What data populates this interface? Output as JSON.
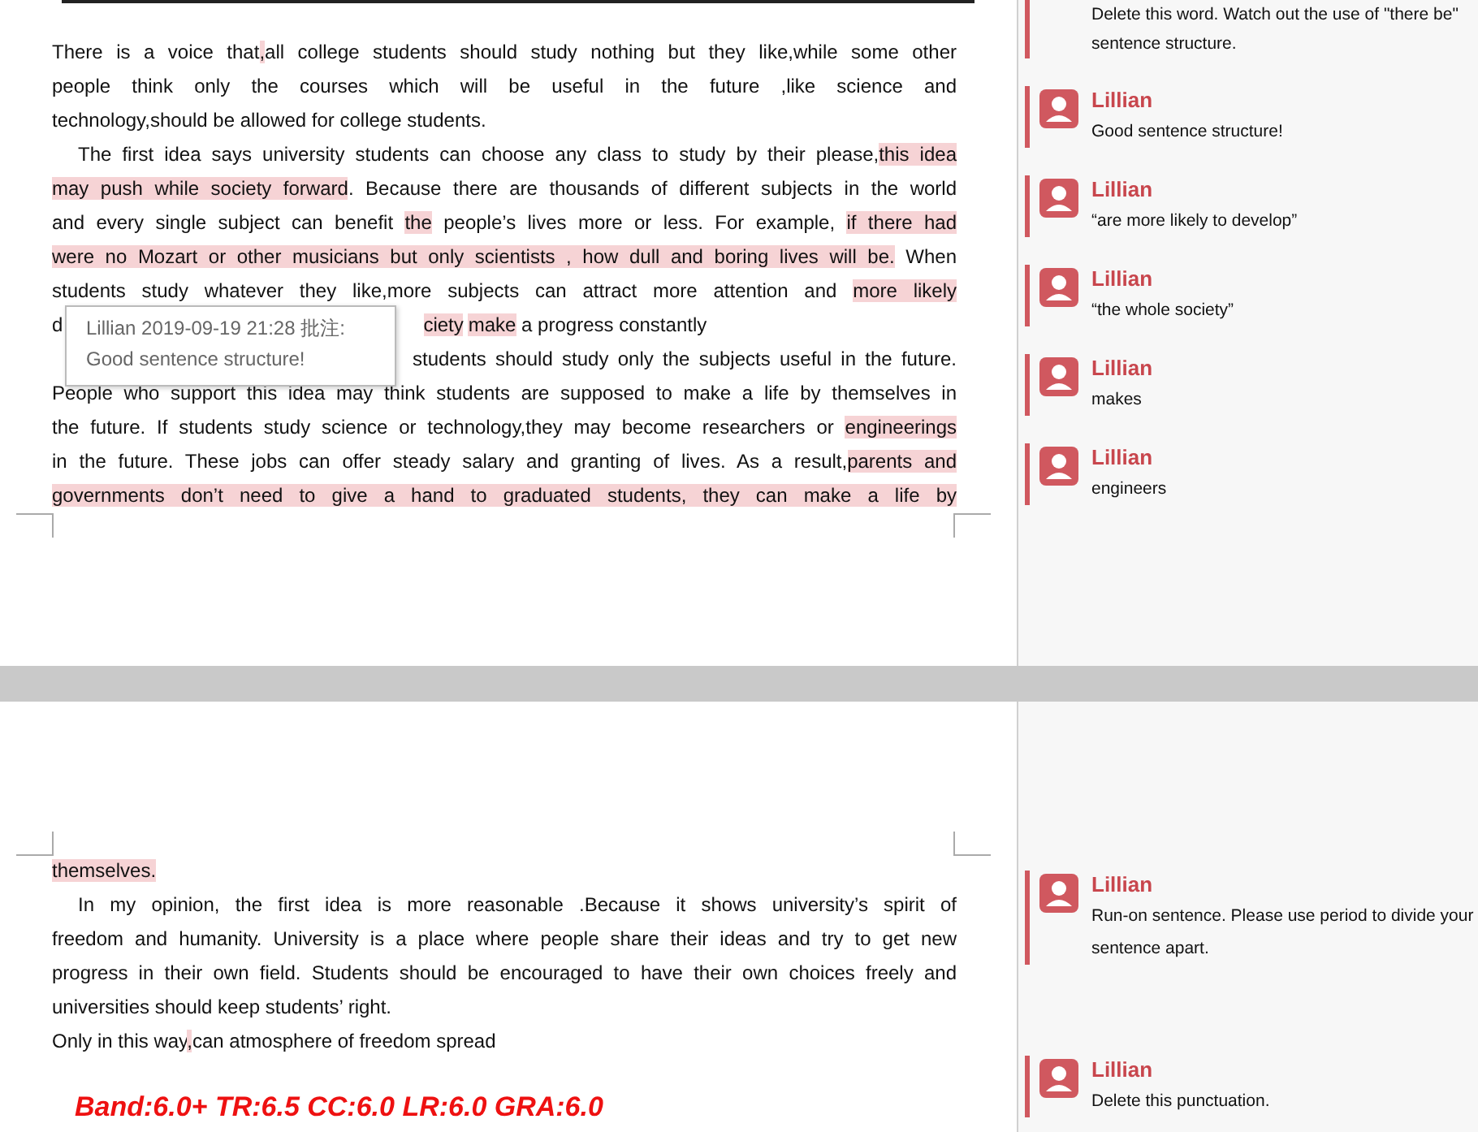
{
  "pages": [
    {
      "lines": [
        {
          "indent": false,
          "last": false,
          "segs": [
            {
              "text": "There is a voice that",
              "hl": false
            },
            {
              "text": ",",
              "hl": true
            },
            {
              "text": "all college students should study nothing but they like,while some other",
              "hl": false
            }
          ]
        },
        {
          "indent": false,
          "last": false,
          "segs": [
            {
              "text": "people think only the courses which will be useful in the future ,like science and",
              "hl": false
            }
          ]
        },
        {
          "indent": false,
          "last": true,
          "segs": [
            {
              "text": "technology,should be allowed for college students.",
              "hl": false
            }
          ]
        },
        {
          "indent": true,
          "last": false,
          "segs": [
            {
              "text": "The first idea says university students can choose any class to study by their please,",
              "hl": false
            },
            {
              "text": "this idea",
              "hl": true
            }
          ]
        },
        {
          "indent": false,
          "last": false,
          "segs": [
            {
              "text": "may push while society forward",
              "hl": true
            },
            {
              "text": ". Because there are thousands of different subjects in the world",
              "hl": false
            }
          ]
        },
        {
          "indent": false,
          "last": false,
          "segs": [
            {
              "text": "and every single subject can benefit ",
              "hl": false
            },
            {
              "text": "the",
              "hl": true
            },
            {
              "text": " people’s lives more or less. For example, ",
              "hl": false
            },
            {
              "text": "if there had",
              "hl": true
            }
          ]
        },
        {
          "indent": false,
          "last": false,
          "segs": [
            {
              "text": "were no Mozart or other musicians but only scientists , how dull and boring lives will be.",
              "hl": true
            },
            {
              "text": " When",
              "hl": false
            }
          ]
        },
        {
          "indent": false,
          "last": false,
          "segs": [
            {
              "text": "students study whatever they like,more subjects can attract more attention and ",
              "hl": false
            },
            {
              "text": "more likely",
              "hl": true
            }
          ]
        },
        {
          "indent": false,
          "last": true,
          "segs": [
            {
              "text": "d",
              "hl": false
            },
            {
              "text": "ciety",
              "hl": true,
              "gap_before": true
            },
            {
              "text": "make",
              "hl": true
            },
            {
              "text": " a progress constantly",
              "hl": false
            }
          ]
        },
        {
          "indent": false,
          "last": false,
          "segs": [
            {
              "text": "students should study only the subjects useful in the future.",
              "hl": false,
              "gap_before": true
            }
          ]
        },
        {
          "indent": false,
          "last": false,
          "segs": [
            {
              "text": "People who support this idea may think students are supposed to make a life by themselves in",
              "hl": false
            }
          ]
        },
        {
          "indent": false,
          "last": false,
          "segs": [
            {
              "text": "the future. If students study science or technology,they may become researchers or ",
              "hl": false
            },
            {
              "text": "engineerings",
              "hl": true
            }
          ]
        },
        {
          "indent": false,
          "last": false,
          "segs": [
            {
              "text": "in the future. These jobs can offer steady salary and granting of lives. As a result,",
              "hl": false
            },
            {
              "text": "parents and",
              "hl": true
            }
          ]
        },
        {
          "indent": false,
          "last": false,
          "segs": [
            {
              "text": "governments don’t need to give a hand to graduated students, they can make a life by",
              "hl": true
            }
          ]
        }
      ],
      "comments": [
        {
          "text": "Delete this word. Watch out the use of \"there be\" sentence structure."
        },
        {
          "author": "Lillian",
          "text": "Good sentence structure!"
        },
        {
          "author": "Lillian",
          "text": "“are more likely to develop”"
        },
        {
          "author": "Lillian",
          "text": "“the whole society”"
        },
        {
          "author": "Lillian",
          "text": "makes"
        },
        {
          "author": "Lillian",
          "text": "engineers"
        }
      ],
      "tooltip": {
        "header": "Lillian 2019-09-19 21:28 批注:",
        "text": "Good sentence structure!"
      }
    },
    {
      "lines": [
        {
          "indent": false,
          "last": true,
          "segs": [
            {
              "text": "themselves.",
              "hl": true
            }
          ]
        },
        {
          "indent": true,
          "last": false,
          "segs": [
            {
              "text": "In my opinion, the first idea is more reasonable .Because it shows university’s spirit of",
              "hl": false
            }
          ]
        },
        {
          "indent": false,
          "last": false,
          "segs": [
            {
              "text": "freedom and humanity. University is a place where people share their ideas and try to get new",
              "hl": false
            }
          ]
        },
        {
          "indent": false,
          "last": false,
          "segs": [
            {
              "text": "progress in their own field. Students should be encouraged to have their own choices freely and",
              "hl": false
            }
          ]
        },
        {
          "indent": false,
          "last": true,
          "segs": [
            {
              "text": "universities should keep students’ right.",
              "hl": false
            }
          ]
        },
        {
          "indent": false,
          "last": true,
          "segs": [
            {
              "text": "Only in this way",
              "hl": false
            },
            {
              "text": ",",
              "hl": true
            },
            {
              "text": "can atmosphere of freedom spread",
              "hl": false
            }
          ]
        }
      ],
      "comments": [
        {
          "author": "Lillian",
          "text": "Run-on sentence. Please use period to divide your sentence apart."
        },
        {
          "author": "Lillian",
          "text": "Delete this punctuation."
        }
      ],
      "score": "Band:6.0+ TR:6.5 CC:6.0 LR:6.0 GRA:6.0"
    }
  ]
}
